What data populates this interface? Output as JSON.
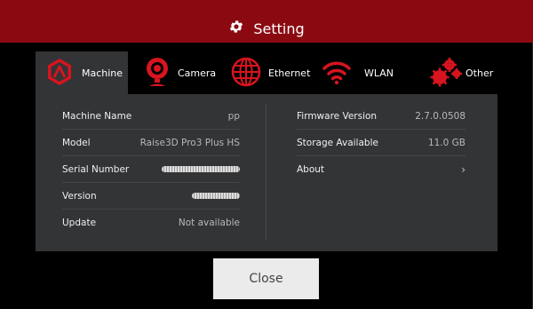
{
  "header": {
    "title": "Setting"
  },
  "tabs": [
    {
      "label": "Machine",
      "icon": "machine-logo-icon",
      "active": true
    },
    {
      "label": "Camera",
      "icon": "camera-icon",
      "active": false
    },
    {
      "label": "Ethernet",
      "icon": "globe-icon",
      "active": false
    },
    {
      "label": "WLAN",
      "icon": "wifi-icon",
      "active": false
    },
    {
      "label": "Other",
      "icon": "gears-icon",
      "active": false
    }
  ],
  "machine_info": [
    {
      "label": "Machine Name",
      "value": "pp"
    },
    {
      "label": "Model",
      "value": "Raise3D Pro3 Plus HS"
    },
    {
      "label": "Serial Number",
      "value": ""
    },
    {
      "label": "Version",
      "value": ""
    },
    {
      "label": "Update",
      "value": "Not available"
    }
  ],
  "system_info": [
    {
      "label": "Firmware Version",
      "value": "2.7.0.0508"
    },
    {
      "label": "Storage Available",
      "value": "11.0 GB"
    },
    {
      "label": "About",
      "value": ""
    }
  ],
  "footer": {
    "close_label": "Close"
  },
  "colors": {
    "accent": "#8b0a12",
    "panel": "#333436",
    "icon_red": "#d7141f"
  }
}
